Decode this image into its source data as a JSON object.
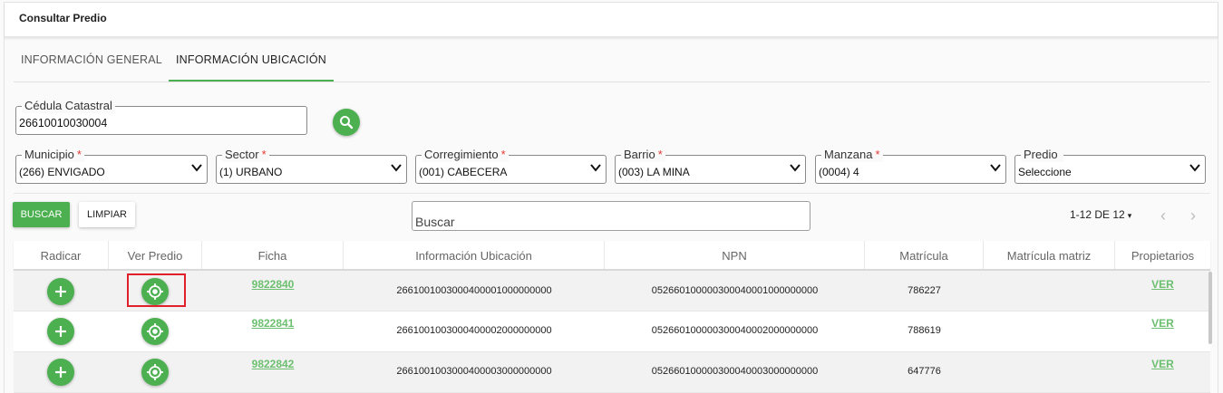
{
  "header": {
    "title": "Consultar Predio"
  },
  "tabs": [
    {
      "label": "INFORMACIÓN GENERAL",
      "active": false
    },
    {
      "label": "INFORMACIÓN UBICACIÓN",
      "active": true
    }
  ],
  "cedula": {
    "label": "Cédula Catastral",
    "value": "26610010030004"
  },
  "filters": [
    {
      "label": "Municipio",
      "required": "*",
      "value": "(266) ENVIGADO"
    },
    {
      "label": "Sector",
      "required": "*",
      "value": "(1) URBANO"
    },
    {
      "label": "Corregimiento",
      "required": "*",
      "value": "(001) CABECERA"
    },
    {
      "label": "Barrio",
      "required": "*",
      "value": "(003) LA MINA"
    },
    {
      "label": "Manzana",
      "required": "*",
      "value": "(0004) 4"
    },
    {
      "label": "Predio",
      "required": "",
      "value": "Seleccione"
    }
  ],
  "toolbar": {
    "buscar_label": "BUSCAR",
    "limpiar_label": "LIMPIAR",
    "search_placeholder": "Buscar"
  },
  "pager": {
    "label": "1-12 DE 12",
    "caret": "▾",
    "prev": "‹",
    "next": "›"
  },
  "table": {
    "columns": [
      "Radicar",
      "Ver Predio",
      "Ficha",
      "Información Ubicación",
      "NPN",
      "Matrícula",
      "Matrícula matriz",
      "Propietarios"
    ],
    "rows": [
      {
        "ficha": "9822840",
        "ubicacion": "2661001003000400001000000000",
        "npn": "052660100000300040001000000000",
        "matricula": "786227",
        "matricula_matriz": "",
        "propietarios": "VER"
      },
      {
        "ficha": "9822841",
        "ubicacion": "2661001003000400002000000000",
        "npn": "052660100000300040002000000000",
        "matricula": "788619",
        "matricula_matriz": "",
        "propietarios": "VER"
      },
      {
        "ficha": "9822842",
        "ubicacion": "2661001003000400003000000000",
        "npn": "052660100000300040003000000000",
        "matricula": "647776",
        "matricula_matriz": "",
        "propietarios": "VER"
      }
    ]
  },
  "colors": {
    "accent": "#4caf50",
    "link": "#6bbf6e",
    "highlight": "#e0202a",
    "required": "#e53935"
  }
}
